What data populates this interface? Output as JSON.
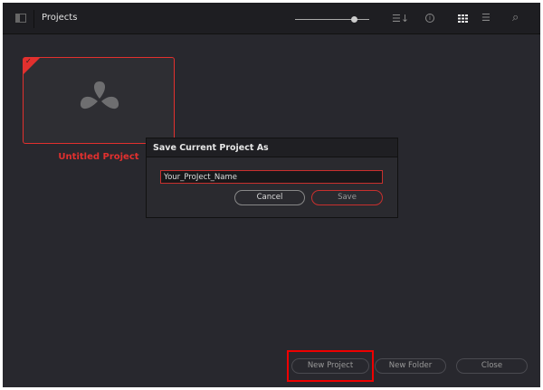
{
  "header": {
    "title": "Projects",
    "icons": [
      "sidebar-toggle-icon",
      "zoom-slider",
      "sort-icon",
      "info-icon",
      "grid-view-icon",
      "list-view-icon",
      "search-icon"
    ],
    "zoom_slider_value": 0.8
  },
  "projects": [
    {
      "name": "Untitled Project",
      "selected": true
    }
  ],
  "dialog": {
    "title": "Save Current Project As",
    "input_value": "Your_ProJect_Name",
    "cancel_label": "Cancel",
    "save_label": "Save"
  },
  "footer": {
    "new_project_label": "New Project",
    "new_folder_label": "New Folder",
    "close_label": "Close"
  },
  "colors": {
    "accent": "#e2302e",
    "background": "#28282e",
    "highlight": "#ee0000"
  }
}
